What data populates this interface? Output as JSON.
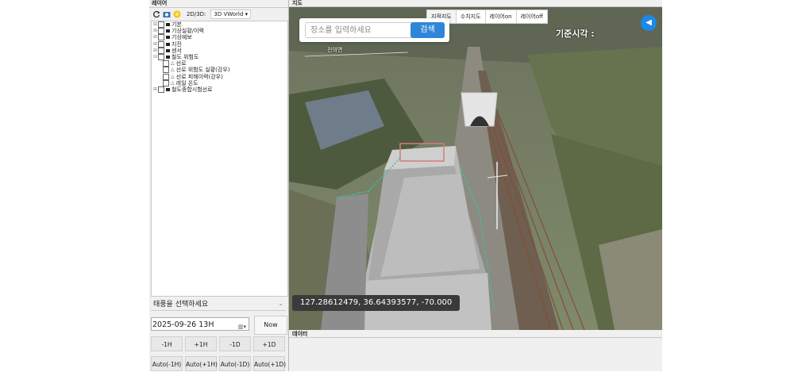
{
  "left_panel": {
    "title": "레이어",
    "toolbar": {
      "mode_label": "2D/3D:",
      "mode_value": "3D VWorld",
      "icons": [
        "refresh-icon",
        "camera-icon",
        "sun-icon"
      ]
    },
    "tree": [
      {
        "label": "기본",
        "level": 0,
        "expander": "⊞"
      },
      {
        "label": "기상실황/이력",
        "level": 0,
        "expander": "⊞"
      },
      {
        "label": "기상예보",
        "level": 0,
        "expander": "⊞"
      },
      {
        "label": "지진",
        "level": 0,
        "expander": "⊞"
      },
      {
        "label": "센서",
        "level": 0,
        "expander": "⊞"
      },
      {
        "label": "철도 위험도",
        "level": 0,
        "expander": "⊟"
      },
      {
        "label": "선로",
        "level": 1,
        "expander": ""
      },
      {
        "label": "선로 위험도 실황(강우)",
        "level": 1,
        "expander": ""
      },
      {
        "label": "선로 피해이력(강우)",
        "level": 1,
        "expander": ""
      },
      {
        "label": "레일 온도",
        "level": 1,
        "expander": ""
      },
      {
        "label": "철도종합시험선로",
        "level": 0,
        "expander": "⊞"
      }
    ],
    "typhoon_placeholder": "태풍을 선택하세요",
    "datetime_value": "2025-09-26 13H",
    "now_label": "Now",
    "step_buttons": [
      "-1H",
      "+1H",
      "-1D",
      "+1D"
    ],
    "auto_buttons": [
      "Auto(-1H)",
      "Auto(+1H)",
      "Auto(-1D)",
      "Auto(+1D)"
    ]
  },
  "map_panel": {
    "title": "지도",
    "search": {
      "placeholder": "장소를 입력하세요",
      "button_label": "검색"
    },
    "tabs": [
      "지적지도",
      "수치지도",
      "레이어on",
      "레이어off"
    ],
    "time_label": "기준시각 :",
    "coords": "127.28612479, 36.64393577, -70.000",
    "map_label": "전의면"
  },
  "data_panel": {
    "title": "데이터"
  },
  "colors": {
    "accent": "#2f86d9",
    "back_button": "#1e88e5",
    "coord_bg": "#3a3a3a"
  }
}
